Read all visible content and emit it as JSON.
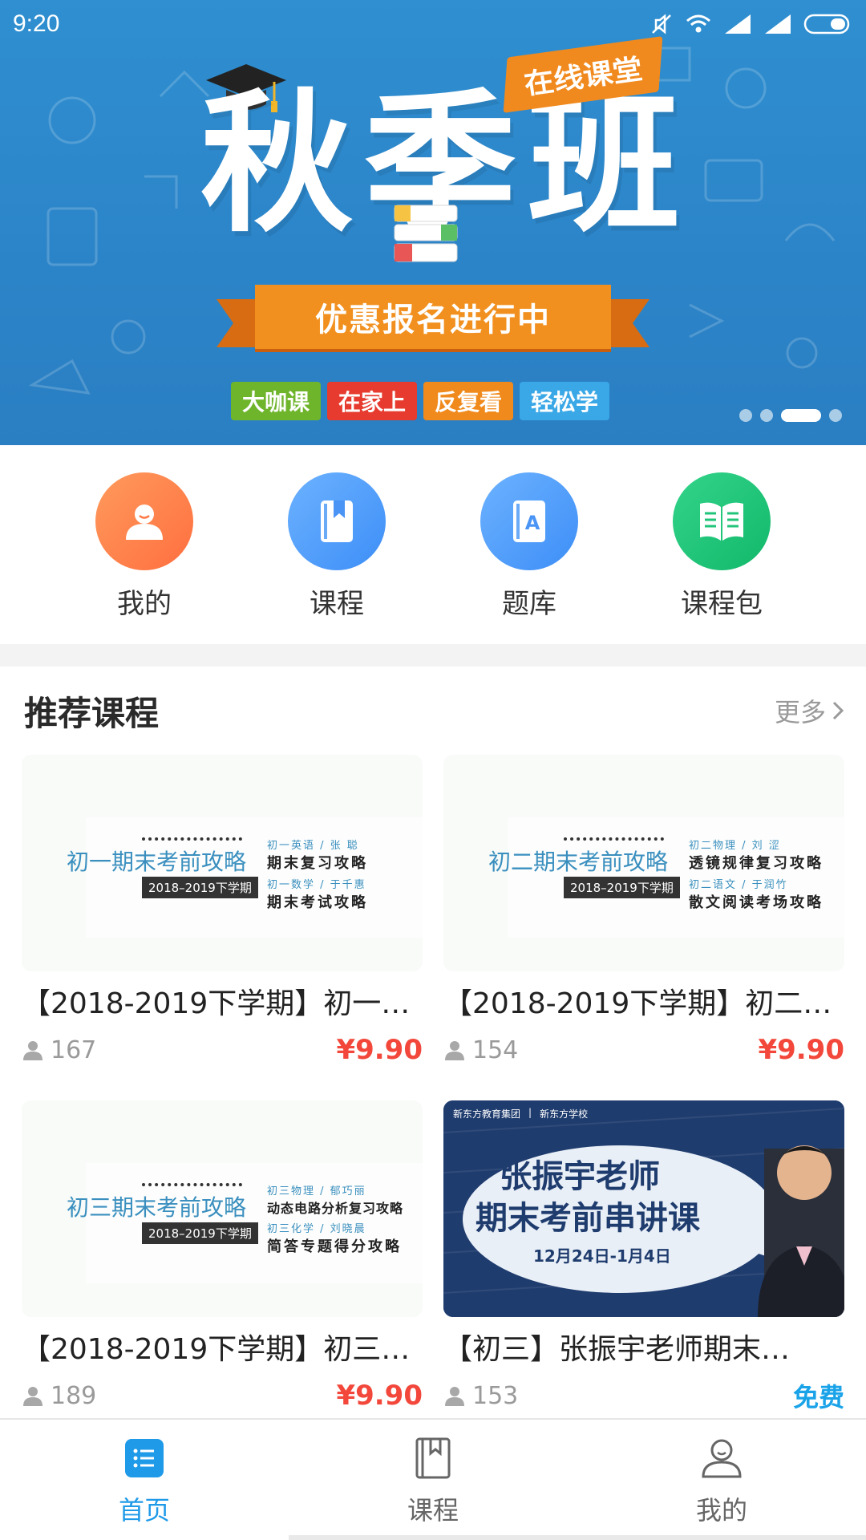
{
  "status_bar": {
    "time": "9:20"
  },
  "banner": {
    "headline": "秋季班",
    "online_tag": "在线课堂",
    "ribbon": "优惠报名进行中",
    "tags": [
      {
        "label": "大咖课",
        "color": "#6fb52c"
      },
      {
        "label": "在家上",
        "color": "#e63b2e"
      },
      {
        "label": "反复看",
        "color": "#f08a1c"
      },
      {
        "label": "轻松学",
        "color": "#3aa7e6"
      }
    ],
    "active_slide": 3,
    "slide_count": 4
  },
  "quick_nav": [
    {
      "label": "我的",
      "icon": "person-icon",
      "color_from": "#ff9a5c",
      "color_to": "#ff6f3f"
    },
    {
      "label": "课程",
      "icon": "book-bookmark-icon",
      "color_from": "#6cb2ff",
      "color_to": "#3d8ef7"
    },
    {
      "label": "题库",
      "icon": "question-bank-icon",
      "color_from": "#6cb2ff",
      "color_to": "#3d8ef7"
    },
    {
      "label": "课程包",
      "icon": "open-book-icon",
      "color_from": "#33d48a",
      "color_to": "#12b86a"
    }
  ],
  "section": {
    "title": "推荐课程",
    "more": "更多"
  },
  "courses": [
    {
      "title": "【2018-2019下学期】初一…",
      "learners": "167",
      "price": "¥9.90",
      "thumb": {
        "heading": "初一期末考前攻略",
        "term": "2018–2019下学期",
        "line1_small": "初一英语 / 张 聪",
        "line1_big": "期末复习攻略",
        "line2_small": "初一数学 / 于千惠",
        "line2_big": "期末考试攻略"
      }
    },
    {
      "title": "【2018-2019下学期】初二…",
      "learners": "154",
      "price": "¥9.90",
      "thumb": {
        "heading": "初二期末考前攻略",
        "term": "2018–2019下学期",
        "line1_small": "初二物理 / 刘 涩",
        "line1_big": "透镜规律复习攻略",
        "line2_small": "初二语文 / 于润竹",
        "line2_big": "散文阅读考场攻略"
      }
    },
    {
      "title": "【2018-2019下学期】初三…",
      "learners": "189",
      "price": "¥9.90",
      "thumb": {
        "heading": "初三期末考前攻略",
        "term": "2018–2019下学期",
        "line1_small": "初三物理 / 郁巧丽",
        "line1_big": "动态电路分析复习攻略",
        "line2_small": "初三化学 / 刘晓晨",
        "line2_big": "简答专题得分攻略"
      }
    },
    {
      "title": "【初三】张振宇老师期末…",
      "learners": "153",
      "price": "免费",
      "thumb": {
        "brand_left": "新东方教育集团",
        "brand_right": "新东方学校",
        "heading_1": "张振宇老师",
        "heading_2": "期末考前串讲课",
        "dates": "12月24日-1月4日"
      }
    }
  ],
  "tabbar": [
    {
      "label": "首页",
      "icon": "home-list-icon",
      "active": true
    },
    {
      "label": "课程",
      "icon": "book-icon",
      "active": false
    },
    {
      "label": "我的",
      "icon": "profile-icon",
      "active": false
    }
  ],
  "colors": {
    "accent": "#1e9ae8",
    "price": "#f2473a",
    "banner_bg": "#2c84c8"
  }
}
